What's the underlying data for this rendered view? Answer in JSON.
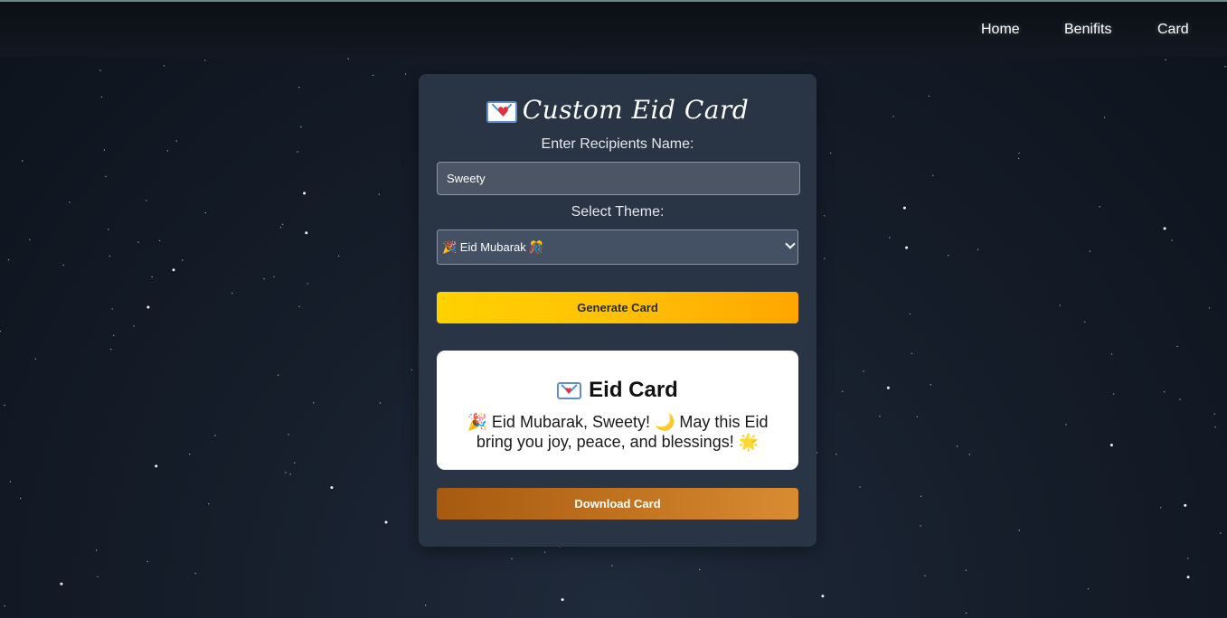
{
  "nav": {
    "home": "Home",
    "benefits": "Benifits",
    "card": "Card"
  },
  "form": {
    "title": "Custom Eid Card",
    "name_label": "Enter Recipients Name:",
    "name_value": "Sweety",
    "theme_label": "Select Theme:",
    "theme_selected": "🎉 Eid Mubarak 🎊",
    "generate_label": "Generate Card",
    "download_label": "Download Card"
  },
  "card": {
    "title": "Eid Card",
    "message": "🎉 Eid Mubarak, Sweety! 🌙 May this Eid bring you joy, peace, and blessings! 🌟"
  },
  "icons": {
    "title_icon": "love-letter-icon",
    "card_icon": "love-letter-icon",
    "select_arrow": "chevron-down-icon"
  },
  "colors": {
    "background": "#161e2b",
    "panel": "#293445",
    "generate_button": "#ffc107",
    "download_button": "#c27420",
    "card": "#ffffff"
  }
}
